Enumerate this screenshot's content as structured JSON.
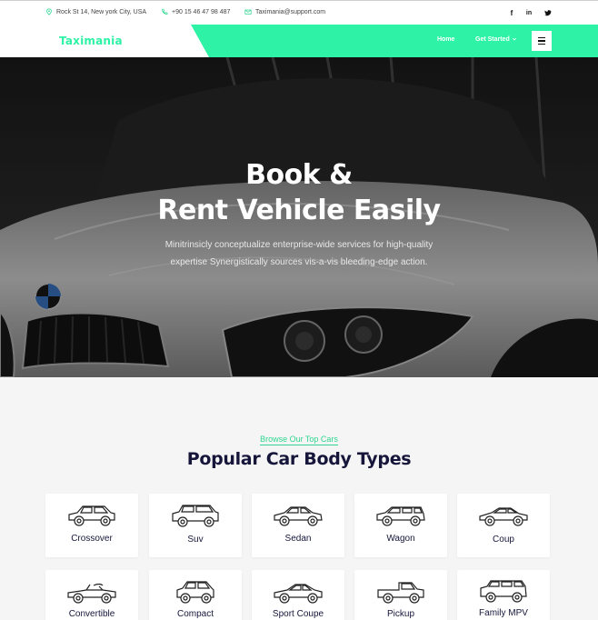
{
  "topbar": {
    "address": "Rock St 14, New york City, USA",
    "phone": "+90 15 46 47 98 487",
    "email": "Taximania@support.com",
    "social": [
      {
        "icon": "facebook-icon",
        "glyph": "f"
      },
      {
        "icon": "linkedin-icon",
        "glyph": "in"
      },
      {
        "icon": "twitter-icon",
        "glyph": "t"
      }
    ]
  },
  "header": {
    "logo": "Taximania",
    "nav": {
      "home": "Home",
      "get_started": "Get Started"
    },
    "accent_color": "#2ef2a5"
  },
  "hero": {
    "title_line1": "Book &",
    "title_line2": "Rent Vehicle Easily",
    "subtitle_line1": "Minitrinsicly conceptualize enterprise-wide services for high-quality",
    "subtitle_line2": "expertise Synergistically sources vis-a-vis bleeding-edge action."
  },
  "section": {
    "eyebrow": "Browse Our Top Cars",
    "title": "Popular Car Body Types",
    "cards": [
      {
        "label": "Crossover",
        "icon": "crossover-car-icon"
      },
      {
        "label": "Suv",
        "icon": "suv-car-icon"
      },
      {
        "label": "Sedan",
        "icon": "sedan-car-icon"
      },
      {
        "label": "Wagon",
        "icon": "wagon-car-icon"
      },
      {
        "label": "Coup",
        "icon": "coupe-car-icon"
      },
      {
        "label": "Convertible",
        "icon": "convertible-car-icon"
      },
      {
        "label": "Compact",
        "icon": "compact-car-icon"
      },
      {
        "label": "Sport Coupe",
        "icon": "sport-coupe-car-icon"
      },
      {
        "label": "Pickup",
        "icon": "pickup-truck-icon"
      },
      {
        "label": "Family MPV",
        "icon": "family-mpv-car-icon"
      }
    ]
  }
}
